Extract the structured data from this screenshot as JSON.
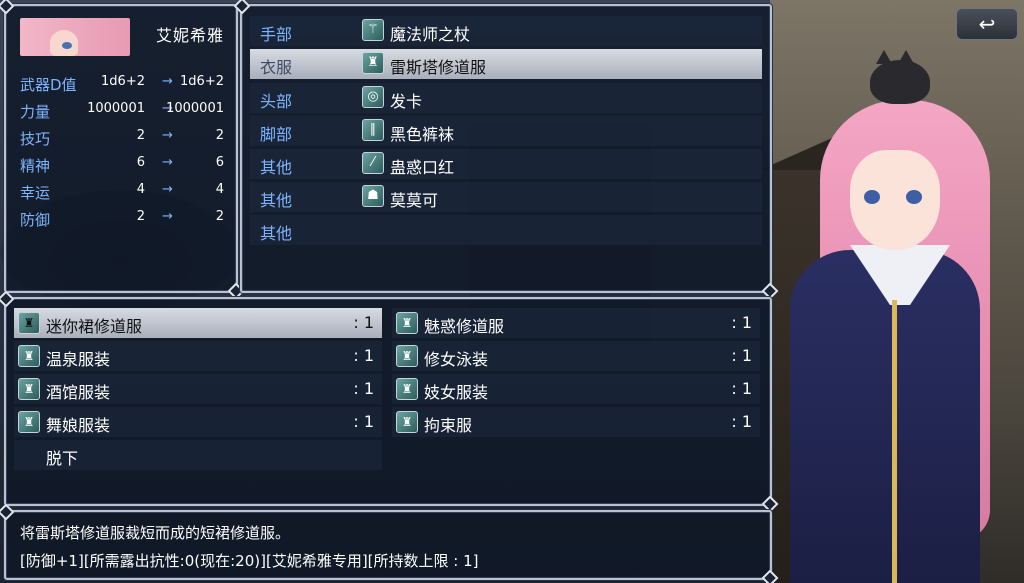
{
  "status": {
    "character_name": "艾妮希雅",
    "stats": [
      {
        "label": "武器D值",
        "current": "1d6+2",
        "arrow": "→",
        "new": "1d6+2"
      },
      {
        "label": "力量",
        "current": "1000001",
        "arrow": "→",
        "new": "1000001"
      },
      {
        "label": "技巧",
        "current": "2",
        "arrow": "→",
        "new": "2"
      },
      {
        "label": "精神",
        "current": "6",
        "arrow": "→",
        "new": "6"
      },
      {
        "label": "幸运",
        "current": "4",
        "arrow": "→",
        "new": "4"
      },
      {
        "label": "防御",
        "current": "2",
        "arrow": "→",
        "new": "2"
      }
    ]
  },
  "equipment": {
    "slots": [
      {
        "slot": "手部",
        "item": "魔法师之杖",
        "icon": "staff-icon"
      },
      {
        "slot": "衣服",
        "item": "雷斯塔修道服",
        "icon": "robe-icon",
        "selected": true
      },
      {
        "slot": "头部",
        "item": "发卡",
        "icon": "hairclip-icon"
      },
      {
        "slot": "脚部",
        "item": "黑色裤袜",
        "icon": "stockings-icon"
      },
      {
        "slot": "其他",
        "item": "蛊惑口红",
        "icon": "lipstick-icon"
      },
      {
        "slot": "其他",
        "item": "莫莫可",
        "icon": "cat-icon"
      },
      {
        "slot": "其他",
        "item": ""
      }
    ]
  },
  "items": {
    "left": [
      {
        "name": "迷你裙修道服",
        "count": ": 1",
        "selected": true
      },
      {
        "name": "温泉服装",
        "count": ": 1"
      },
      {
        "name": "酒馆服装",
        "count": ": 1"
      },
      {
        "name": "舞娘服装",
        "count": ": 1"
      },
      {
        "name": "脱下",
        "count": ""
      }
    ],
    "right": [
      {
        "name": "魅惑修道服",
        "count": ": 1"
      },
      {
        "name": "修女泳装",
        "count": ": 1"
      },
      {
        "name": "妓女服装",
        "count": ": 1"
      },
      {
        "name": "拘束服",
        "count": ": 1"
      }
    ]
  },
  "help": {
    "line1": "将雷斯塔修道服裁短而成的短裙修道服。",
    "line2": "[防御+1][所需露出抗性:0(现在:20)][艾妮希雅专用][所持数上限 : 1]"
  },
  "back_button": {
    "label": "↩"
  },
  "colors": {
    "label_blue": "#7eb4ff",
    "selection": "#c4c9d2",
    "window_border": "#b8c2d0"
  }
}
